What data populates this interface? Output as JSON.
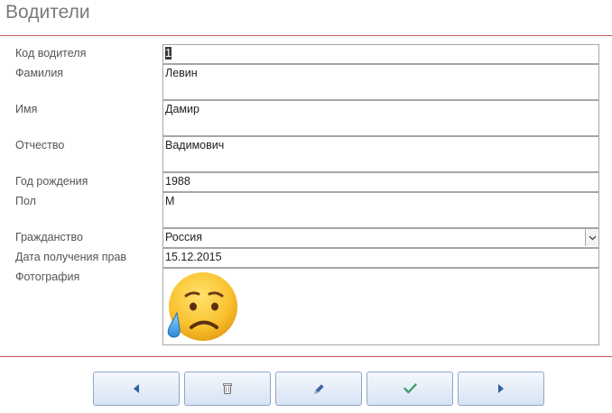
{
  "window": {
    "title": "Водители"
  },
  "form": {
    "fields": [
      {
        "label": "Код водителя",
        "value": "1"
      },
      {
        "label": "Фамилия",
        "value": "Левин"
      },
      {
        "label": "Имя",
        "value": "Дамир"
      },
      {
        "label": "Отчество",
        "value": "Вадимович"
      },
      {
        "label": "Год рождения",
        "value": "1988"
      },
      {
        "label": "Пол",
        "value": "М"
      },
      {
        "label": "Гражданство",
        "value": "Россия"
      },
      {
        "label": "Дата получения прав",
        "value": "15.12.2015"
      },
      {
        "label": "Фотография",
        "value": ""
      }
    ]
  },
  "toolbar": {
    "buttons": [
      {
        "icon": "arrow-left-icon"
      },
      {
        "icon": "trash-icon"
      },
      {
        "icon": "pencil-icon"
      },
      {
        "icon": "checkmark-icon"
      },
      {
        "icon": "arrow-right-icon"
      }
    ]
  },
  "colors": {
    "divider": "#c45a5a",
    "button_border": "#8fa6c7",
    "accent": "#3b6fb6"
  }
}
